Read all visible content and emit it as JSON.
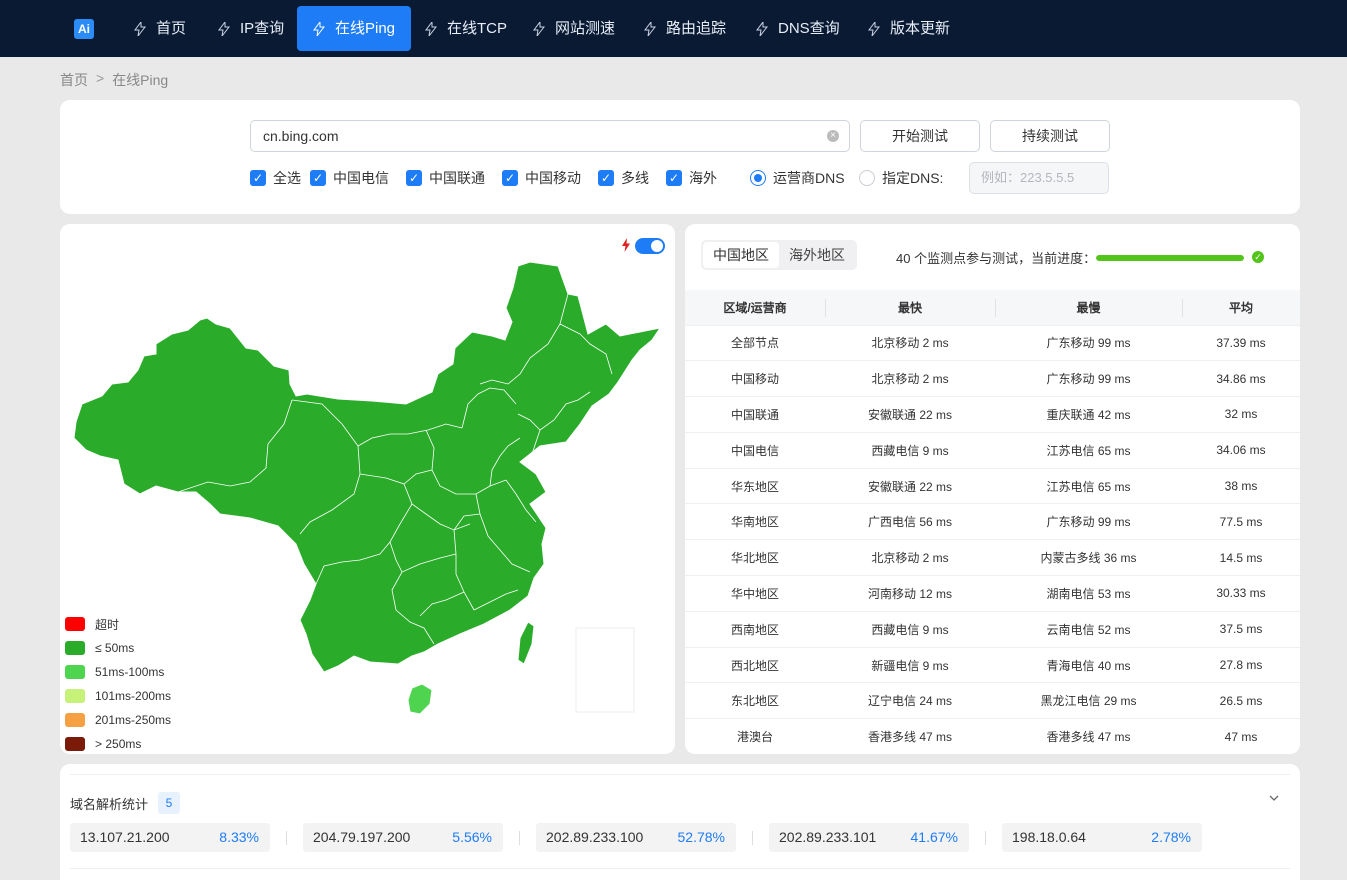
{
  "nav": {
    "logo": "Ai",
    "items": [
      {
        "label": "首页"
      },
      {
        "label": "IP查询"
      },
      {
        "label": "在线Ping"
      },
      {
        "label": "在线TCP"
      },
      {
        "label": "网站测速"
      },
      {
        "label": "路由追踪"
      },
      {
        "label": "DNS查询"
      },
      {
        "label": "版本更新"
      }
    ],
    "active_index": 2
  },
  "breadcrumb": {
    "home": "首页",
    "sep": ">",
    "current": "在线Ping"
  },
  "search": {
    "value": "cn.bing.com",
    "start_button": "开始测试",
    "continuous_button": "持续测试",
    "options": {
      "select_all": "全选",
      "telecom": "中国电信",
      "unicom": "中国联通",
      "mobile": "中国移动",
      "multi": "多线",
      "overseas": "海外"
    },
    "dns": {
      "carrier": "运营商DNS",
      "custom": "指定DNS:",
      "placeholder": "例如：223.5.5.5"
    }
  },
  "map": {
    "legend": [
      {
        "label": "超时",
        "color": "#ff0000"
      },
      {
        "label": "≤ 50ms",
        "color": "#2aac2a"
      },
      {
        "label": "51ms-100ms",
        "color": "#4fd44f"
      },
      {
        "label": "101ms-200ms",
        "color": "#c6f27a"
      },
      {
        "label": "201ms-250ms",
        "color": "#f5a042"
      },
      {
        "label": "> 250ms",
        "color": "#7a1a08"
      }
    ]
  },
  "results": {
    "tabs": [
      "中国地区",
      "海外地区"
    ],
    "progress_text": "40 个监测点参与测试，当前进度：",
    "progress": 1.0,
    "columns": [
      "区域/运营商",
      "最快",
      "最慢",
      "平均"
    ],
    "rows": [
      [
        "全部节点",
        "北京移动 2 ms",
        "广东移动 99 ms",
        "37.39 ms"
      ],
      [
        "中国移动",
        "北京移动 2 ms",
        "广东移动 99 ms",
        "34.86 ms"
      ],
      [
        "中国联通",
        "安徽联通 22 ms",
        "重庆联通 42 ms",
        "32 ms"
      ],
      [
        "中国电信",
        "西藏电信 9 ms",
        "江苏电信 65 ms",
        "34.06 ms"
      ],
      [
        "华东地区",
        "安徽联通 22 ms",
        "江苏电信 65 ms",
        "38 ms"
      ],
      [
        "华南地区",
        "广西电信 56 ms",
        "广东移动 99 ms",
        "77.5 ms"
      ],
      [
        "华北地区",
        "北京移动 2 ms",
        "内蒙古多线 36 ms",
        "14.5 ms"
      ],
      [
        "华中地区",
        "河南移动 12 ms",
        "湖南电信 53 ms",
        "30.33 ms"
      ],
      [
        "西南地区",
        "西藏电信 9 ms",
        "云南电信 52 ms",
        "37.5 ms"
      ],
      [
        "西北地区",
        "新疆电信 9 ms",
        "青海电信 40 ms",
        "27.8 ms"
      ],
      [
        "东北地区",
        "辽宁电信 24 ms",
        "黑龙江电信 29 ms",
        "26.5 ms"
      ],
      [
        "港澳台",
        "香港多线 47 ms",
        "香港多线 47 ms",
        "47 ms"
      ]
    ]
  },
  "dns_stats": {
    "title": "域名解析统计",
    "count": "5",
    "ips": [
      {
        "ip": "13.107.21.200",
        "pct": "8.33%"
      },
      {
        "ip": "204.79.197.200",
        "pct": "5.56%"
      },
      {
        "ip": "202.89.233.100",
        "pct": "52.78%"
      },
      {
        "ip": "202.89.233.101",
        "pct": "41.67%"
      },
      {
        "ip": "198.18.0.64",
        "pct": "2.78%"
      }
    ]
  }
}
